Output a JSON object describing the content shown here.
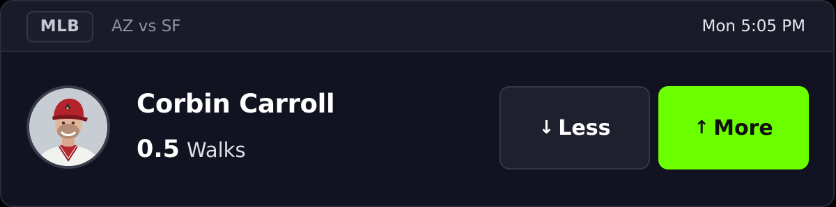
{
  "header": {
    "league": "MLB",
    "matchup": "AZ vs SF",
    "time": "Mon 5:05 PM"
  },
  "player": {
    "name": "Corbin Carroll",
    "avatar_icon": "player-headshot",
    "line_value": "0.5",
    "stat_type": "Walks"
  },
  "actions": {
    "less": {
      "arrow": "↓",
      "label": "Less",
      "icon": "arrow-down-icon"
    },
    "more": {
      "arrow": "↑",
      "label": "More",
      "icon": "arrow-up-icon",
      "color": "#6cff00"
    }
  },
  "colors": {
    "card_background": "#121320",
    "header_background": "#1a1b29",
    "accent": "#6cff00"
  }
}
